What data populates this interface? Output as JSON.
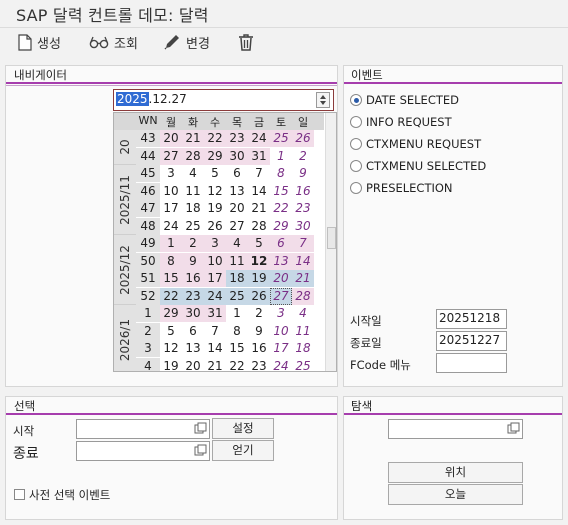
{
  "window": {
    "title": "SAP 달력 컨트롤 데모: 달력"
  },
  "toolbar": {
    "create_label": "생성",
    "display_label": "조회",
    "change_label": "변경",
    "icons": [
      "new-document-icon",
      "glasses-icon",
      "pencil-icon",
      "trash-icon"
    ]
  },
  "navigator": {
    "title": "내비게이터",
    "date_value_highlight": "2025",
    "date_value_rest": ".12.27",
    "calendar": {
      "header": [
        "WN",
        "월",
        "화",
        "수",
        "목",
        "금",
        "토",
        "일"
      ],
      "months": [
        "20",
        "2025/11",
        "2025/12",
        "2026/1"
      ],
      "weeks": [
        {
          "wn": "43",
          "days": [
            "20",
            "21",
            "22",
            "23",
            "24",
            "25",
            "26"
          ]
        },
        {
          "wn": "44",
          "days": [
            "27",
            "28",
            "29",
            "30",
            "31",
            "1",
            "2"
          ]
        },
        {
          "wn": "45",
          "days": [
            "3",
            "4",
            "5",
            "6",
            "7",
            "8",
            "9"
          ]
        },
        {
          "wn": "46",
          "days": [
            "10",
            "11",
            "12",
            "13",
            "14",
            "15",
            "16"
          ]
        },
        {
          "wn": "47",
          "days": [
            "17",
            "18",
            "19",
            "20",
            "21",
            "22",
            "23"
          ]
        },
        {
          "wn": "48",
          "days": [
            "24",
            "25",
            "26",
            "27",
            "28",
            "29",
            "30"
          ]
        },
        {
          "wn": "49",
          "days": [
            "1",
            "2",
            "3",
            "4",
            "5",
            "6",
            "7"
          ]
        },
        {
          "wn": "50",
          "days": [
            "8",
            "9",
            "10",
            "11",
            "12",
            "13",
            "14"
          ]
        },
        {
          "wn": "51",
          "days": [
            "15",
            "16",
            "17",
            "18",
            "19",
            "20",
            "21"
          ]
        },
        {
          "wn": "52",
          "days": [
            "22",
            "23",
            "24",
            "25",
            "26",
            "27",
            "28"
          ]
        },
        {
          "wn": "1",
          "days": [
            "29",
            "30",
            "31",
            "1",
            "2",
            "3",
            "4"
          ]
        },
        {
          "wn": "2",
          "days": [
            "5",
            "6",
            "7",
            "8",
            "9",
            "10",
            "11"
          ]
        },
        {
          "wn": "3",
          "days": [
            "12",
            "13",
            "14",
            "15",
            "16",
            "17",
            "18"
          ]
        },
        {
          "wn": "4",
          "days": [
            "19",
            "20",
            "21",
            "22",
            "23",
            "24",
            "25"
          ]
        }
      ],
      "today": "12",
      "colors": {
        "month_tint": "#f2dde9",
        "selected": "#c6d8e6",
        "weekend_text": "#7a2f86"
      }
    }
  },
  "events": {
    "title": "이벤트",
    "options": [
      {
        "label": "DATE SELECTED",
        "selected": true
      },
      {
        "label": "INFO REQUEST",
        "selected": false
      },
      {
        "label": "CTXMENU REQUEST",
        "selected": false
      },
      {
        "label": "CTXMENU SELECTED",
        "selected": false
      },
      {
        "label": "PRESELECTION",
        "selected": false
      }
    ],
    "start_label": "시작일",
    "start_value": "20251218",
    "end_label": "종료일",
    "end_value": "20251227",
    "fcode_label": "FCode 메뉴",
    "fcode_value": ""
  },
  "selection": {
    "title": "선택",
    "start_label": "시작",
    "start_value": "",
    "end_label": "종료",
    "end_value": "",
    "set_button": "설정",
    "get_button": "얻기",
    "preselect_label": "사전 선택 이벤트"
  },
  "search": {
    "title": "탐색",
    "value": "",
    "position_button": "위치",
    "today_button": "오늘"
  }
}
